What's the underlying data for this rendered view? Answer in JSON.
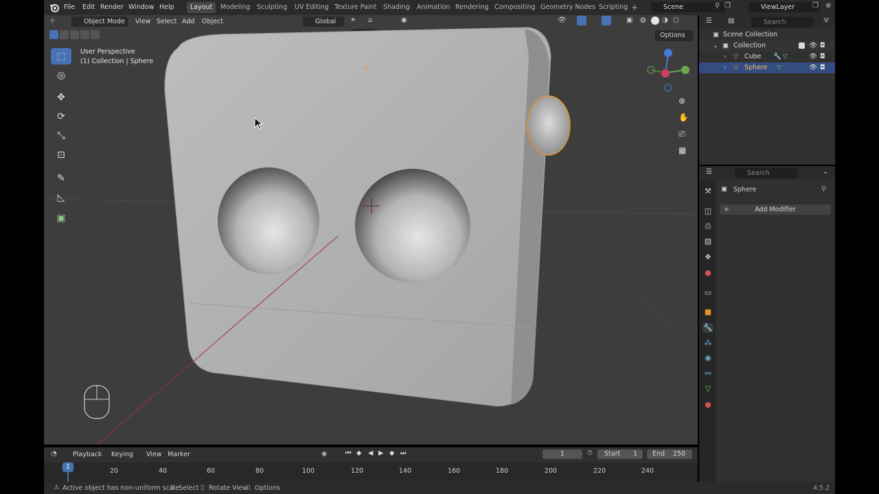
{
  "topbar": {
    "menus": [
      "File",
      "Edit",
      "Render",
      "Window",
      "Help"
    ],
    "workspaces": [
      "Layout",
      "Modeling",
      "Sculpting",
      "UV Editing",
      "Texture Paint",
      "Shading",
      "Animation",
      "Rendering",
      "Compositing",
      "Geometry Nodes",
      "Scripting"
    ],
    "active_workspace": "Layout",
    "scene": "Scene",
    "view_layer": "ViewLayer"
  },
  "viewport_header": {
    "mode": "Object Mode",
    "menus": [
      "View",
      "Select",
      "Add",
      "Object"
    ],
    "transform_orientation": "Global",
    "options": "Options"
  },
  "viewport": {
    "perspective_label": "User Perspective",
    "context_label": "(1) Collection | Sphere"
  },
  "outliner": {
    "search_placeholder": "Search",
    "scene_collection": "Scene Collection",
    "collection": "Collection",
    "objects": [
      "Cube",
      "Sphere"
    ],
    "selected": "Sphere"
  },
  "properties": {
    "search_placeholder": "Search",
    "object_name": "Sphere",
    "add_modifier": "Add Modifier"
  },
  "timeline": {
    "menus": [
      "Playback",
      "Keying",
      "View",
      "Marker"
    ],
    "current_frame": "1",
    "start_label": "Start",
    "start": "1",
    "end_label": "End",
    "end": "250",
    "ticks": [
      "20",
      "40",
      "60",
      "80",
      "100",
      "120",
      "140",
      "160",
      "180",
      "200",
      "220",
      "240"
    ],
    "playhead": "1"
  },
  "statusbar": {
    "warning": "Active object has non-uniform scale",
    "select": "Select",
    "rotate_view": "Rotate View",
    "options": "Options",
    "version": "4.5.2"
  },
  "colors": {
    "accent": "#4772b3",
    "selection_outline": "#e8902a",
    "header_bg": "#2b2b2b",
    "viewport_bg": "#3d3d3d"
  }
}
